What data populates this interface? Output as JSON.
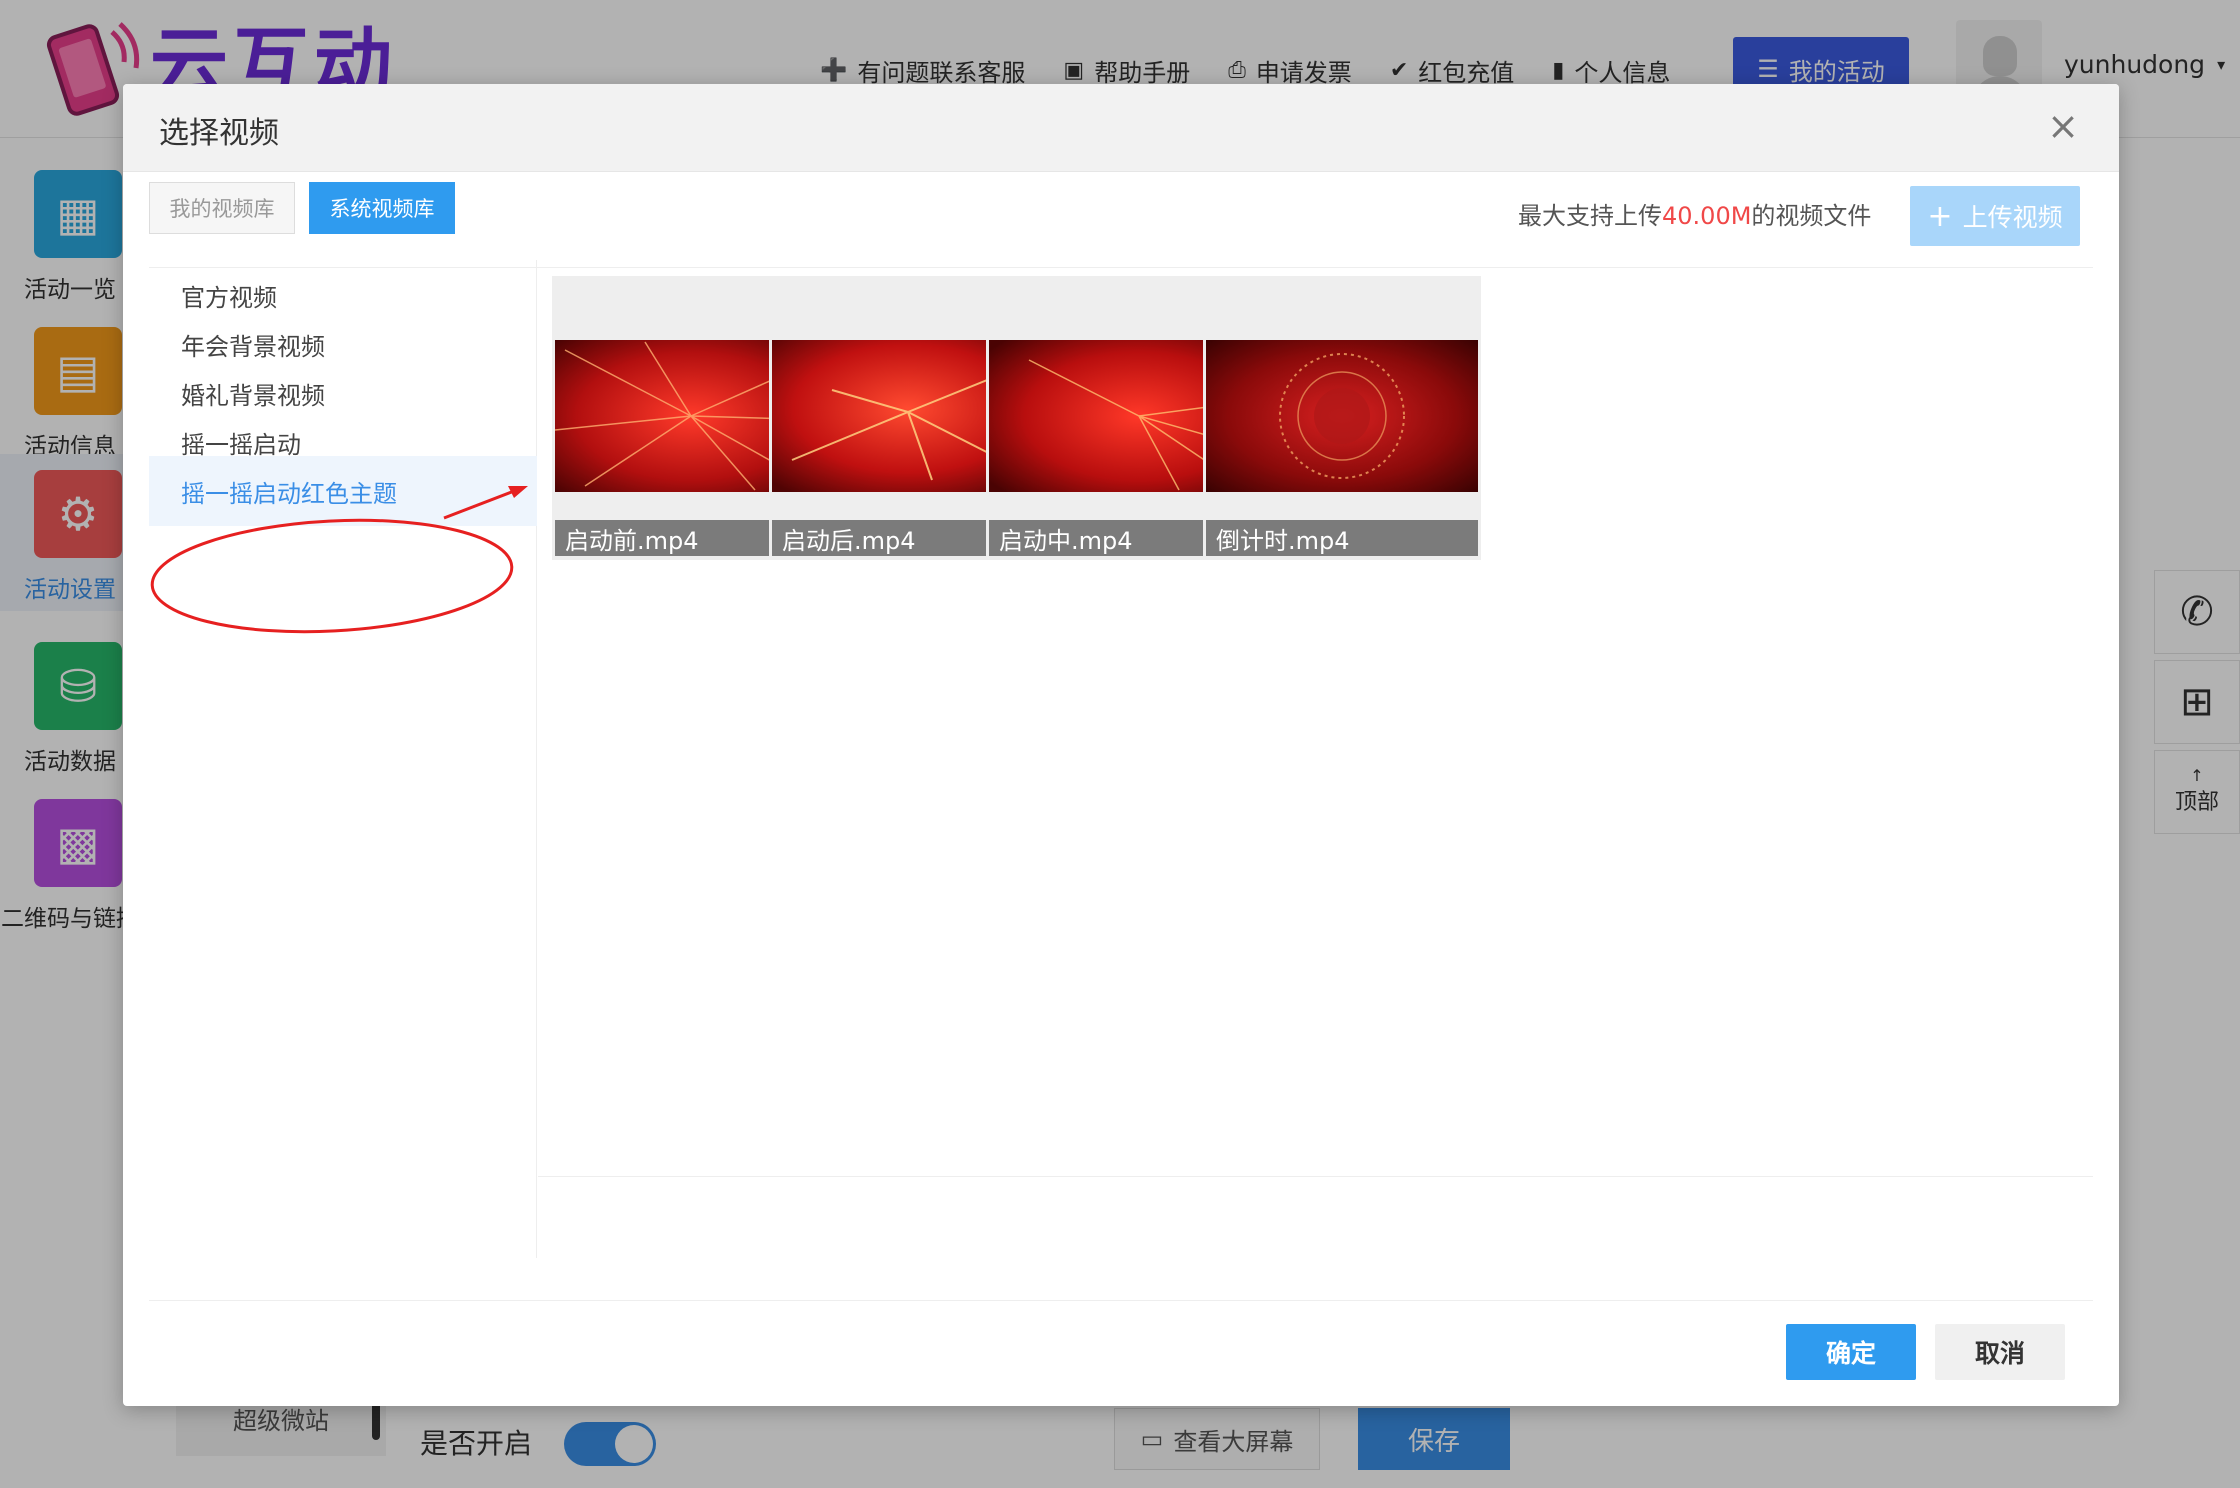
{
  "header": {
    "logo_text": "云互动",
    "nav": [
      {
        "icon": "add-user-icon",
        "glyph": "➕",
        "label": "有问题联系客服"
      },
      {
        "icon": "book-icon",
        "glyph": "▣",
        "label": "帮助手册"
      },
      {
        "icon": "printer-icon",
        "glyph": "⎙",
        "label": "申请发票"
      },
      {
        "icon": "check-shield-icon",
        "glyph": "✔",
        "label": "红包充值"
      },
      {
        "icon": "document-icon",
        "glyph": "▮",
        "label": "个人信息"
      }
    ],
    "my_activity": {
      "icon": "list-icon",
      "glyph": "☰",
      "label": "我的活动"
    },
    "username": "yunhudong",
    "caret": "▾"
  },
  "sidebar": {
    "items": [
      {
        "label": "活动一览",
        "icon": "grid-icon",
        "glyph": "▦",
        "color": "#2aa8de"
      },
      {
        "label": "活动信息",
        "icon": "document-icon",
        "glyph": "▤",
        "color": "#f39a1b"
      },
      {
        "label": "活动设置",
        "icon": "gear-icon",
        "glyph": "⚙",
        "color": "#f05a5a"
      },
      {
        "label": "活动数据",
        "icon": "database-icon",
        "glyph": "⛁",
        "color": "#27b86a"
      },
      {
        "label": "二维码与链接",
        "icon": "qrcode-icon",
        "glyph": "▩",
        "color": "#b64fe0"
      }
    ]
  },
  "bottom": {
    "tab_label": "超级微站",
    "open_label": "是否开启",
    "view_screen": "查看大屏幕",
    "view_icon": "▭",
    "save": "保存"
  },
  "right_tools": {
    "phone_glyph": "✆",
    "qr_glyph": "⊞",
    "top_arrow": "↑",
    "top_label": "顶部"
  },
  "modal": {
    "title": "选择视频",
    "close": "×",
    "tabs": {
      "mine": "我的视频库",
      "system": "系统视频库"
    },
    "limit": {
      "prefix": "最大支持上传",
      "size": "40.00M",
      "suffix": "的视频文件"
    },
    "upload": {
      "plus": "+",
      "label": "上传视频"
    },
    "categories": [
      {
        "label": "官方视频"
      },
      {
        "label": "年会背景视频"
      },
      {
        "label": "婚礼背景视频"
      },
      {
        "label": "摇一摇启动"
      },
      {
        "label": "摇一摇启动红色主题"
      }
    ],
    "active_category": 4,
    "videos": [
      {
        "name": "启动前.mp4"
      },
      {
        "name": "启动后.mp4"
      },
      {
        "name": "启动中.mp4"
      },
      {
        "name": "倒计时.mp4"
      }
    ],
    "ok": "确定",
    "cancel": "取消"
  },
  "colors": {
    "accent": "#2f9bef",
    "highlight": "#f04848",
    "annotation": "#e62020"
  }
}
